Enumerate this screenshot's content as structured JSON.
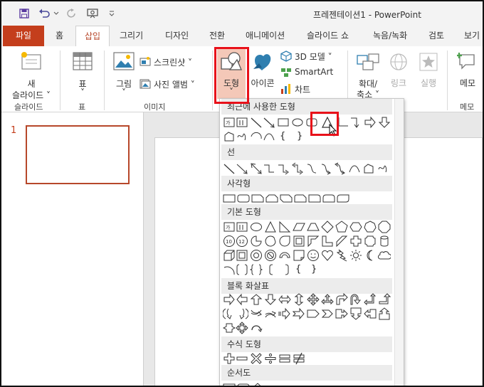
{
  "window": {
    "title": "프레젠테이션1  -  PowerPoint"
  },
  "quick_access": {
    "save_icon": "save-icon",
    "undo_icon": "undo-icon",
    "redo_icon": "redo-icon",
    "presenter_icon": "present-from-beginning-icon"
  },
  "tabs": [
    "파일",
    "홈",
    "삽입",
    "그리기",
    "디자인",
    "전환",
    "애니메이션",
    "슬라이드 쇼",
    "녹음/녹화",
    "검토",
    "보기"
  ],
  "active_tab": "삽입",
  "ribbon": {
    "new_slide": {
      "line1": "새",
      "line2": "슬라이드 ˅"
    },
    "table": {
      "label": "표",
      "arrow": "˅"
    },
    "picture": {
      "label": "그림",
      "arrow": "˅"
    },
    "screenshot": {
      "label": "스크린샷 ˅"
    },
    "photo_album": {
      "label": "사진 앨범 ˅"
    },
    "shapes": {
      "label": "도형",
      "arrow": "˅"
    },
    "icons": {
      "label": "아이콘"
    },
    "model3d": {
      "label": "3D 모델 ˅"
    },
    "smartart": {
      "label": "SmartArt"
    },
    "chart": {
      "label": "차트"
    },
    "zoom": {
      "line1": "확대/",
      "line2": "축소 ˅"
    },
    "link": {
      "label": "링크"
    },
    "action": {
      "label": "실행"
    },
    "comment": {
      "label": "메모"
    },
    "groups": {
      "slides": "슬라이드",
      "tables": "표",
      "images": "이미지",
      "comments": "메모"
    },
    "colors": {
      "accent": "#c43e1c",
      "highlight": "#e8111a",
      "shape_fill": "#f4c8b8"
    }
  },
  "thumbnails": {
    "slide_number": "1"
  },
  "gallery": {
    "sections": [
      {
        "title": "최근에 사용한 도형"
      },
      {
        "title": "선"
      },
      {
        "title": "사각형"
      },
      {
        "title": "기본 도형"
      },
      {
        "title": "블록 화살표"
      },
      {
        "title": "수식 도형"
      },
      {
        "title": "순서도"
      }
    ],
    "curly_open": "{",
    "curly_close": "}",
    "selected_shape": "isosceles-triangle"
  }
}
